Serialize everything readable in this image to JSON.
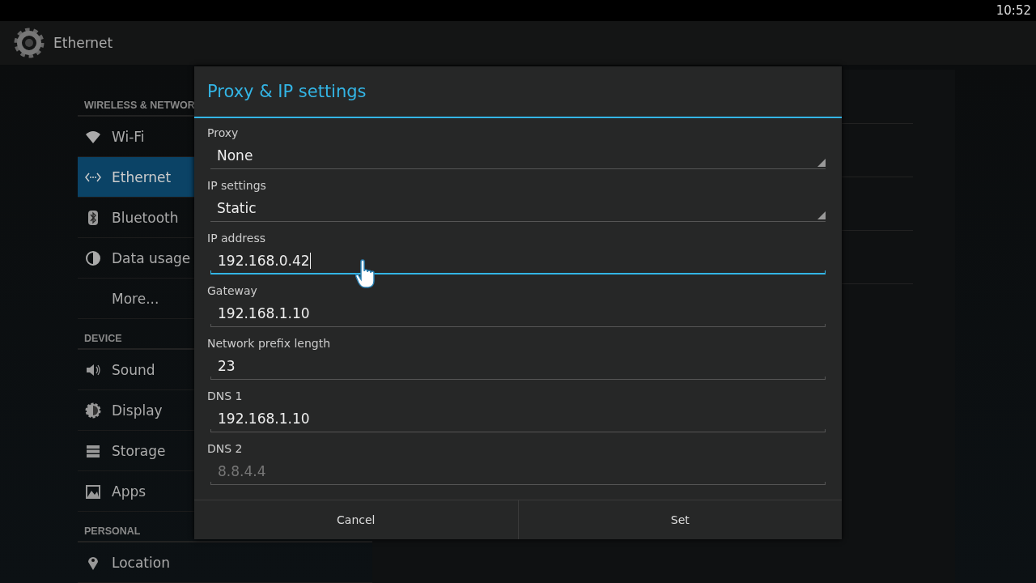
{
  "status_bar": {
    "time": "10:52"
  },
  "action_bar": {
    "title": "Ethernet"
  },
  "sidebar": {
    "sections": [
      {
        "header": "WIRELESS & NETWOR",
        "items": [
          {
            "label": "Wi-Fi",
            "selected": false
          },
          {
            "label": "Ethernet",
            "selected": true
          },
          {
            "label": "Bluetooth",
            "selected": false
          },
          {
            "label": "Data usage",
            "selected": false
          },
          {
            "label": "More...",
            "selected": false
          }
        ]
      },
      {
        "header": "DEVICE",
        "items": [
          {
            "label": "Sound",
            "selected": false
          },
          {
            "label": "Display",
            "selected": false
          },
          {
            "label": "Storage",
            "selected": false
          },
          {
            "label": "Apps",
            "selected": false
          }
        ]
      },
      {
        "header": "PERSONAL",
        "items": [
          {
            "label": "Location",
            "selected": false
          }
        ]
      }
    ]
  },
  "dialog": {
    "title": "Proxy & IP settings",
    "fields": [
      {
        "kind": "dropdown",
        "label": "Proxy",
        "value": "None"
      },
      {
        "kind": "dropdown",
        "label": "IP settings",
        "value": "Static"
      },
      {
        "kind": "text",
        "label": "IP address",
        "value": "192.168.0.42",
        "focused": true
      },
      {
        "kind": "text",
        "label": "Gateway",
        "value": "192.168.1.10",
        "focused": false
      },
      {
        "kind": "text",
        "label": "Network prefix length",
        "value": "23",
        "focused": false
      },
      {
        "kind": "text",
        "label": "DNS 1",
        "value": "192.168.1.10",
        "focused": false
      },
      {
        "kind": "text",
        "label": "DNS 2",
        "placeholder": "8.8.4.4",
        "focused": false
      }
    ],
    "buttons": [
      "Cancel",
      "Set"
    ]
  }
}
